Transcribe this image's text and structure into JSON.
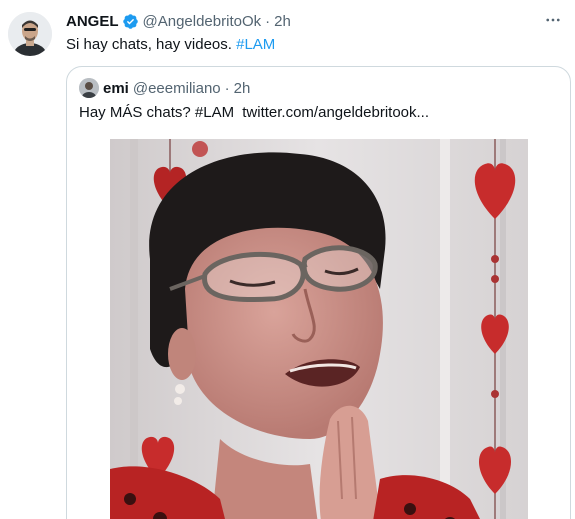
{
  "tweet": {
    "author_name": "ANGEL",
    "author_handle": "@AngeldebritoOk",
    "separator": "·",
    "time": "2h",
    "text_main": "Si hay chats, hay videos.",
    "hashtag": "#LAM",
    "verified_color": "#1d9bf0"
  },
  "quoted_tweet": {
    "author_name": "emi",
    "author_handle": "@eeemiliano",
    "separator": "·",
    "time": "2h",
    "text_main": "Hay MÁS chats?",
    "hashtag": "#LAM",
    "link_text": "twitter.com/angeldebritook..."
  },
  "icons": {
    "verified": "verified-badge-icon",
    "more": "more-options-icon"
  },
  "colors": {
    "accent": "#1d9bf0",
    "secondary_text": "#536471",
    "border": "#cfd9de"
  }
}
